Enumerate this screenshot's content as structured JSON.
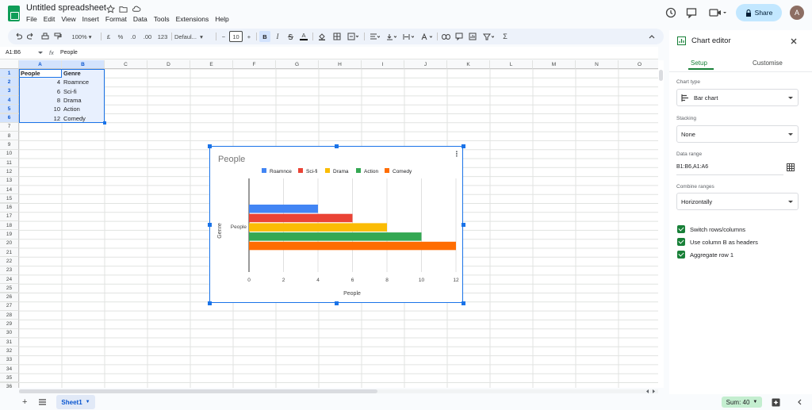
{
  "app": {
    "title": "Untitled spreadsheet",
    "share_label": "Share",
    "avatar_initial": "A"
  },
  "menu": [
    "File",
    "Edit",
    "View",
    "Insert",
    "Format",
    "Data",
    "Tools",
    "Extensions",
    "Help"
  ],
  "toolbar": {
    "zoom": "100%",
    "currency": "£",
    "percent": "%",
    "dec_dec": ".0",
    "dec_inc": ".00",
    "num_format": "123",
    "font": "Defaul...",
    "font_size": "10",
    "bold": "B",
    "italic": "I",
    "text_color": "A",
    "functions": "Σ"
  },
  "formula_bar": {
    "name_box": "A1:B6",
    "fx": "fx",
    "value": "People"
  },
  "columns": [
    "A",
    "B",
    "C",
    "D",
    "E",
    "F",
    "G",
    "H",
    "I",
    "J",
    "K",
    "L",
    "M",
    "N",
    "O"
  ],
  "rows": [
    "1",
    "2",
    "3",
    "4",
    "5",
    "6",
    "7",
    "8",
    "9",
    "10",
    "11",
    "12",
    "13",
    "14",
    "15",
    "16",
    "17",
    "18",
    "19",
    "20",
    "21",
    "22",
    "23",
    "24",
    "25",
    "26",
    "27",
    "28",
    "29",
    "30",
    "31",
    "32",
    "33",
    "34",
    "35",
    "36"
  ],
  "cells": [
    [
      "People",
      "Genre"
    ],
    [
      "4",
      "Roamnce"
    ],
    [
      "6",
      "Sci-fi"
    ],
    [
      "8",
      "Drama"
    ],
    [
      "10",
      "Action"
    ],
    [
      "12",
      "Comedy"
    ]
  ],
  "chart_data": {
    "type": "bar",
    "orientation": "horizontal",
    "title": "People",
    "xlabel": "People",
    "ylabel": "Genre",
    "categories": [
      "People"
    ],
    "series": [
      {
        "name": "Roamnce",
        "values": [
          4
        ],
        "color": "#4285f4"
      },
      {
        "name": "Sci-fi",
        "values": [
          6
        ],
        "color": "#ea4335"
      },
      {
        "name": "Drama",
        "values": [
          8
        ],
        "color": "#fbbc04"
      },
      {
        "name": "Action",
        "values": [
          10
        ],
        "color": "#34a853"
      },
      {
        "name": "Comedy",
        "values": [
          12
        ],
        "color": "#ff6d01"
      }
    ],
    "xlim": [
      0,
      12
    ],
    "xticks": [
      "0",
      "2",
      "4",
      "6",
      "8",
      "10",
      "12"
    ],
    "legend": "top",
    "grid": true
  },
  "editor": {
    "title": "Chart editor",
    "tab_setup": "Setup",
    "tab_customise": "Customise",
    "chart_type_label": "Chart type",
    "chart_type_value": "Bar chart",
    "stacking_label": "Stacking",
    "stacking_value": "None",
    "data_range_label": "Data range",
    "data_range_value": "B1:B6,A1:A6",
    "combine_label": "Combine ranges",
    "combine_value": "Horizontally",
    "checks": [
      "Switch rows/columns",
      "Use column B as headers",
      "Aggregate row 1"
    ]
  },
  "bottom": {
    "sheet": "Sheet1",
    "sum": "Sum: 40"
  },
  "colors": {
    "accent": "#1a73e8",
    "selection": "#e8f0fe",
    "checkbox": "#188038"
  }
}
